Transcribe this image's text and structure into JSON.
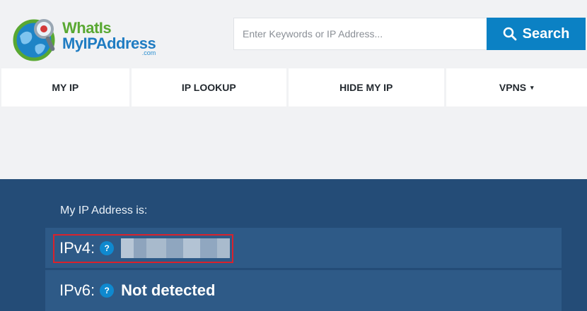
{
  "brand": {
    "line1": "WhatIs",
    "line2": "MyIPAddress",
    "domain_suffix": ".com",
    "green": "#59a832",
    "blue": "#1f7cc2"
  },
  "search": {
    "placeholder": "Enter Keywords or IP Address...",
    "button_label": "Search",
    "button_color": "#0b81c4"
  },
  "nav": {
    "items": [
      "MY IP",
      "IP LOOKUP",
      "HIDE MY IP",
      "VPNS"
    ],
    "dropdown_caret": "▾"
  },
  "panel": {
    "title": "My IP Address is:",
    "ipv4_label": "IPv4:",
    "ipv4_value": "",
    "ipv6_label": "IPv6:",
    "ipv6_value": "Not detected",
    "help_glyph": "?",
    "background": "#244c77",
    "highlight_color": "#d9222c"
  }
}
